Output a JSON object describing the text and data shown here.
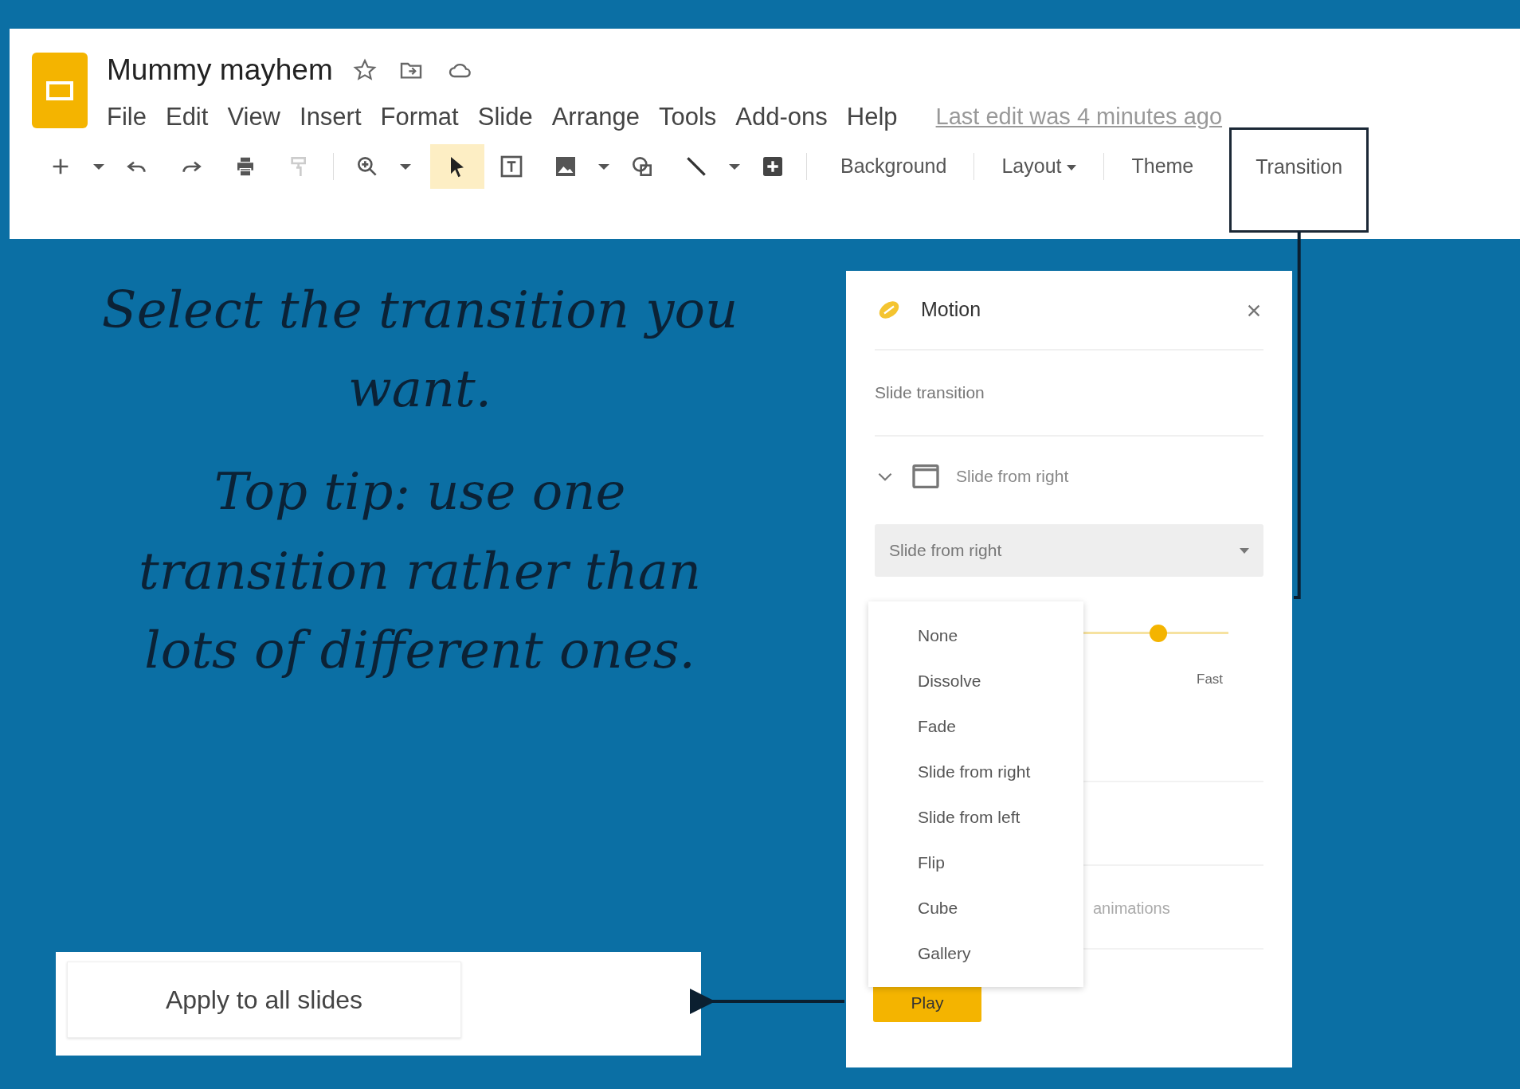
{
  "app": {
    "title": "Mummy mayhem",
    "menu": [
      "File",
      "Edit",
      "View",
      "Insert",
      "Format",
      "Slide",
      "Arrange",
      "Tools",
      "Add-ons",
      "Help"
    ],
    "last_edit": "Last edit was 4 minutes ago"
  },
  "toolbar": {
    "tools": [
      {
        "selected": false
      },
      {
        "selected": false
      },
      {
        "selected": false
      },
      {
        "selected": false
      },
      {
        "selected": false
      },
      {
        "selected": false
      },
      {
        "selected": false
      },
      {
        "selected": false
      },
      {
        "selected": true
      },
      {
        "selected": false
      },
      {
        "selected": false
      },
      {
        "selected": false
      },
      {
        "selected": false
      },
      {
        "selected": false
      },
      {
        "selected": false
      },
      {
        "selected": false
      }
    ],
    "text_buttons": [
      {
        "label": "Background",
        "caret": false,
        "highlighted": false
      },
      {
        "label": "Layout",
        "caret": true,
        "highlighted": false
      },
      {
        "label": "Theme",
        "caret": false,
        "highlighted": false
      },
      {
        "label": "Transition",
        "caret": false,
        "highlighted": true
      }
    ]
  },
  "slide": {
    "instructions": [
      "Select the transition you want.",
      "Top tip: use one transition rather than lots of different ones."
    ],
    "apply_button": "Apply to all slides"
  },
  "panel": {
    "title": "Motion",
    "section": "Slide transition",
    "transition_row": {
      "label": "Slide from right",
      "expanded": true
    },
    "select": {
      "value": "Slide from right"
    },
    "options": [
      {
        "label": "None"
      },
      {
        "label": "Dissolve"
      },
      {
        "label": "Fade"
      },
      {
        "label": "Slide from right"
      },
      {
        "label": "Slide from left"
      },
      {
        "label": "Flip"
      },
      {
        "label": "Cube"
      },
      {
        "label": "Gallery"
      }
    ],
    "speed": {
      "level": 0.8,
      "label": "Fast"
    },
    "partial_text": "animations",
    "play_button": "Play"
  }
}
